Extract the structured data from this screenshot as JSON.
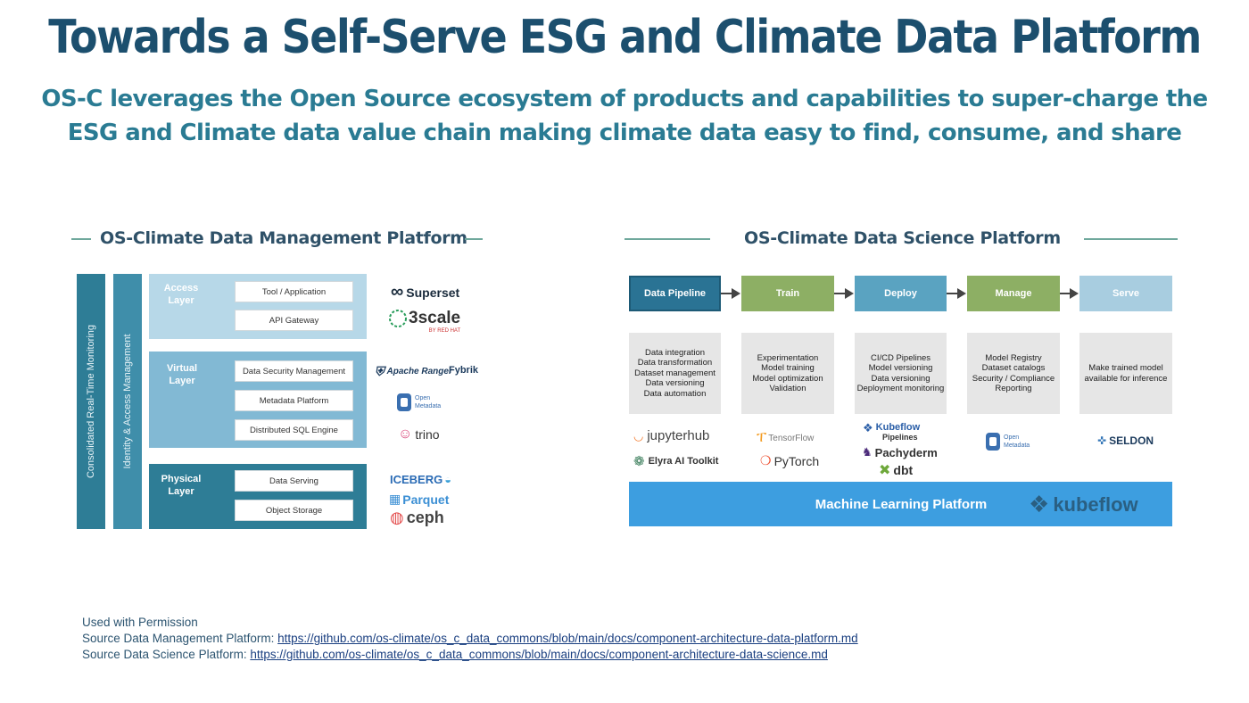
{
  "header": {
    "title": "Towards a Self-Serve ESG and Climate Data Platform",
    "subtitle": "OS-C leverages the Open Source ecosystem of products and capabilities to super-charge the ESG and Climate data value chain making climate data easy to find, consume, and share"
  },
  "data_management": {
    "title": "OS-Climate Data Management Platform",
    "monitoring_label": "Consolidated Real-Time Monitoring",
    "identity_label": "Identity & Access Management",
    "access_layer": {
      "label": "Access Layer",
      "items": [
        "Tool / Application",
        "API Gateway"
      ]
    },
    "virtual_layer": {
      "label": "Virtual Layer",
      "items": [
        "Data Security Management",
        "Metadata Platform",
        "Distributed SQL Engine"
      ]
    },
    "physical_layer": {
      "label": "Physical Layer",
      "items": [
        "Data Serving",
        "Object Storage"
      ]
    },
    "logos": {
      "superset": "Superset",
      "threescale": "3scale",
      "threescale_by": "BY RED HAT",
      "ranger": "Apache Ranger",
      "fybrik": "Fybrik",
      "open_metadata": "Open Metadata",
      "trino": "trino",
      "iceberg": "ICEBERG",
      "parquet": "Parquet",
      "ceph": "ceph"
    }
  },
  "data_science": {
    "title": "OS-Climate Data Science Platform",
    "steps": [
      {
        "label": "Data Pipeline",
        "desc": [
          "Data integration",
          "Data transformation",
          "Dataset management",
          "Data versioning",
          "Data automation"
        ]
      },
      {
        "label": "Train",
        "desc": [
          "Experimentation",
          "Model training",
          "Model optimization",
          "Validation"
        ]
      },
      {
        "label": "Deploy",
        "desc": [
          "CI/CD Pipelines",
          "Model versioning",
          "Data versioning",
          "Deployment monitoring"
        ]
      },
      {
        "label": "Manage",
        "desc": [
          "Model Registry",
          "Dataset catalogs",
          "Security / Compliance",
          "Reporting"
        ]
      },
      {
        "label": "Serve",
        "desc": [
          "Make trained model",
          "available for inference"
        ]
      }
    ],
    "logos": {
      "jupyterhub": "jupyterhub",
      "elyra": "Elyra AI Toolkit",
      "tensorflow": "TensorFlow",
      "pytorch": "PyTorch",
      "kubeflow": "Kubeflow",
      "pipelines": "Pipelines",
      "pachyderm": "Pachyderm",
      "dbt": "dbt",
      "open_metadata": "Open Metadata",
      "seldon": "SELDON"
    },
    "ml_platform": "Machine Learning Platform",
    "kubeflow_logo": "kubeflow"
  },
  "footer": {
    "permission": "Used with Permission",
    "dm_source_label": "Source Data Management Platform: ",
    "dm_source_url": "https://github.com/os-climate/os_c_data_commons/blob/main/docs/component-architecture-data-platform.md",
    "ds_source_label": "Source Data Science Platform: ",
    "ds_source_url": "https://github.com/os-climate/os_c_data_commons/blob/main/docs/component-architecture-data-science.md"
  },
  "colors": {
    "title": "#1c4f6e",
    "subtitle": "#2a7b93",
    "monitoring_bar": "#2e7d96",
    "identity_bar": "#3f8eaa",
    "access_layer": "#b7d8e8",
    "virtual_layer": "#82b9d4",
    "physical_layer": "#2e7d96",
    "data_pipeline": "#2a7394",
    "train": "#8daf64",
    "deploy": "#5aa3c1",
    "manage": "#8daf64",
    "serve": "#a8cde0",
    "ml_platform": "#3d9ee0"
  }
}
